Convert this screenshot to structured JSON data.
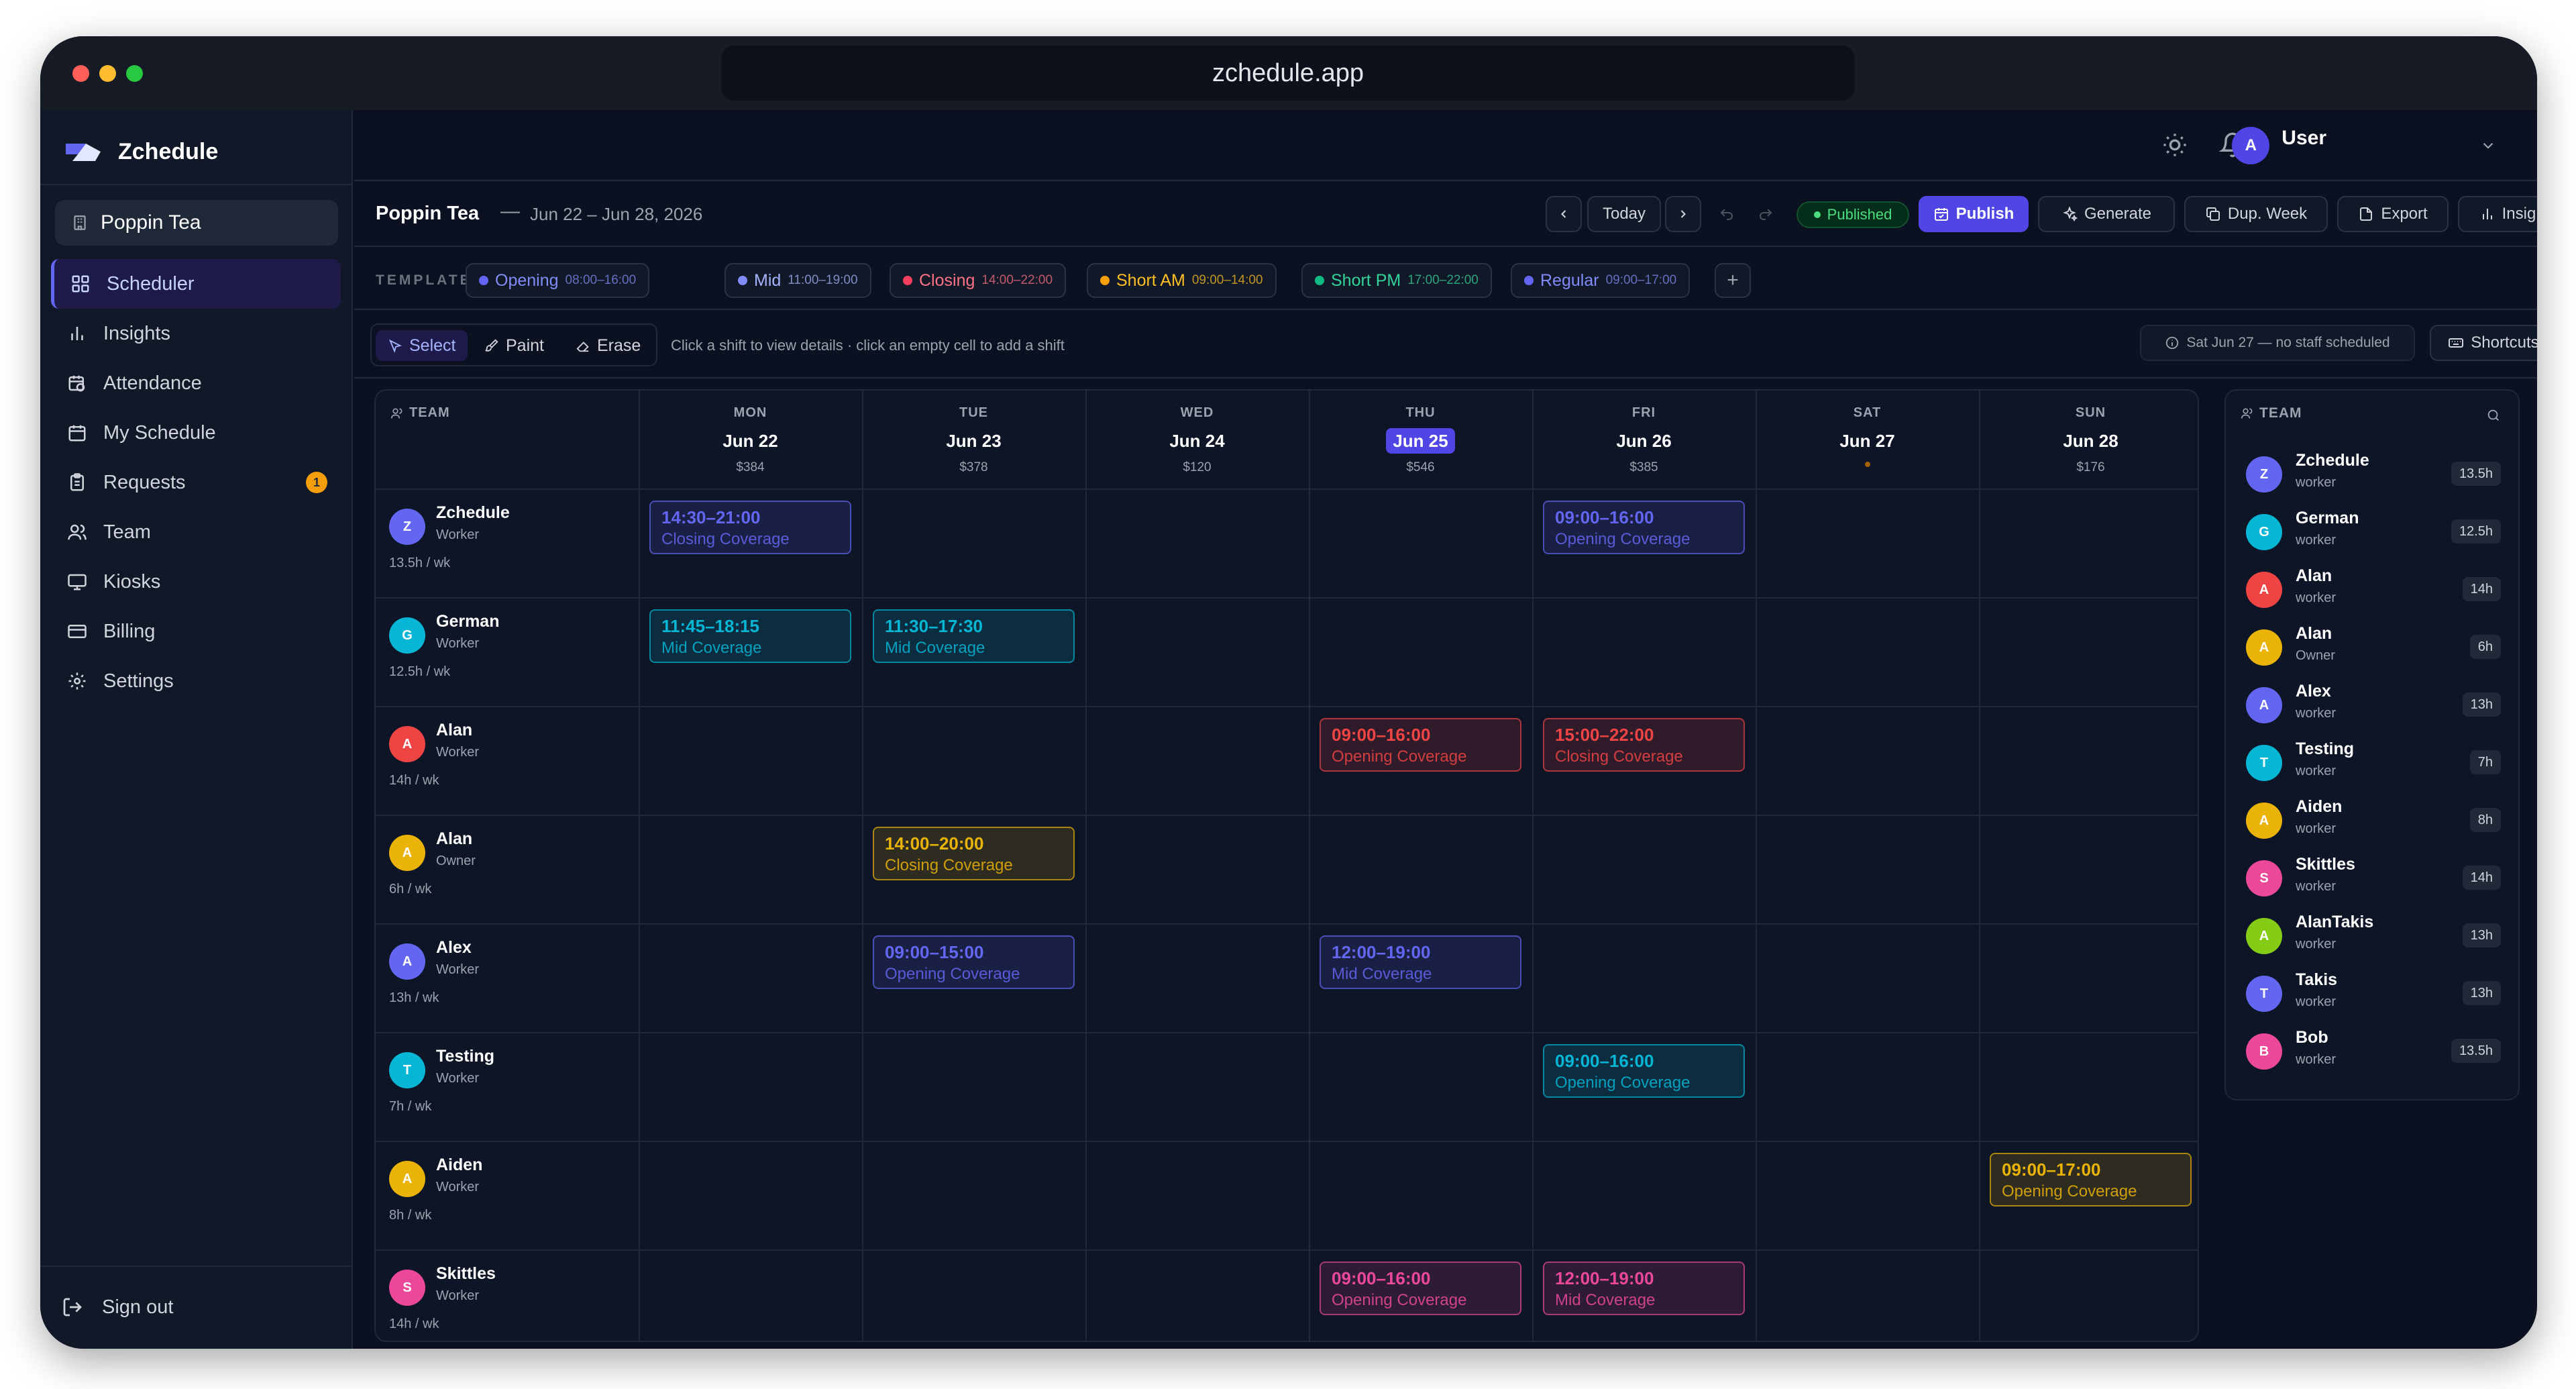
{
  "browser": {
    "url": "zchedule.app"
  },
  "app": {
    "name": "Zchedule",
    "org": "Poppin Tea"
  },
  "sidebar": {
    "items": [
      {
        "label": "Scheduler",
        "icon": "grid-icon",
        "active": true
      },
      {
        "label": "Insights",
        "icon": "bar-chart-icon"
      },
      {
        "label": "Attendance",
        "icon": "calendar-clock-icon"
      },
      {
        "label": "My Schedule",
        "icon": "calendar-icon"
      },
      {
        "label": "Requests",
        "icon": "clipboard-icon",
        "badge": "1"
      },
      {
        "label": "Team",
        "icon": "users-icon"
      },
      {
        "label": "Kiosks",
        "icon": "monitor-icon"
      },
      {
        "label": "Billing",
        "icon": "credit-card-icon"
      },
      {
        "label": "Settings",
        "icon": "gear-icon"
      }
    ],
    "signout": "Sign out"
  },
  "topbar": {
    "user_initial": "A",
    "user_name": "User"
  },
  "header": {
    "title": "Poppin Tea",
    "separator": "—",
    "range": "Jun 22 – Jun 28, 2026",
    "today": "Today",
    "status": "Published",
    "publish": "Publish",
    "generate": "Generate",
    "dup_week": "Dup. Week",
    "export": "Export",
    "insights": "Insights"
  },
  "templates": {
    "label": "TEMPLATES",
    "items": [
      {
        "name": "Opening",
        "time": "08:00–16:00",
        "color": "#6366f1"
      },
      {
        "name": "Mid",
        "time": "11:00–19:00",
        "color": "#818cf8"
      },
      {
        "name": "Closing",
        "time": "14:00–22:00",
        "color": "#f43f5e"
      },
      {
        "name": "Short AM",
        "time": "09:00–14:00",
        "color": "#f59e0b"
      },
      {
        "name": "Short PM",
        "time": "17:00–22:00",
        "color": "#10b981"
      },
      {
        "name": "Regular",
        "time": "09:00–17:00",
        "color": "#6366f1"
      }
    ],
    "add": "+"
  },
  "toolbar": {
    "select": "Select",
    "paint": "Paint",
    "erase": "Erase",
    "hint": "Click a shift to view details · click an empty cell to add a shift",
    "notice": "Sat Jun 27 — no staff scheduled",
    "shortcuts": "Shortcuts"
  },
  "grid": {
    "team_label": "TEAM",
    "days": [
      {
        "name": "MON",
        "date": "Jun 22",
        "cost": "$384"
      },
      {
        "name": "TUE",
        "date": "Jun 23",
        "cost": "$378"
      },
      {
        "name": "WED",
        "date": "Jun 24",
        "cost": "$120"
      },
      {
        "name": "THU",
        "date": "Jun 25",
        "cost": "$546",
        "today": true
      },
      {
        "name": "FRI",
        "date": "Jun 26",
        "cost": "$385"
      },
      {
        "name": "SAT",
        "date": "Jun 27",
        "cost": ""
      },
      {
        "name": "SUN",
        "date": "Jun 28",
        "cost": "$176"
      }
    ],
    "rows": [
      {
        "initial": "Z",
        "name": "Zchedule",
        "role": "Worker",
        "hours": "13.5h / wk",
        "color": "#6366f1",
        "shifts": [
          {
            "day": 0,
            "time": "14:30–21:00",
            "label": "Closing Coverage",
            "color": "#6366f1"
          },
          {
            "day": 4,
            "time": "09:00–16:00",
            "label": "Opening Coverage",
            "color": "#6366f1"
          }
        ]
      },
      {
        "initial": "G",
        "name": "German",
        "role": "Worker",
        "hours": "12.5h / wk",
        "color": "#06b6d4",
        "shifts": [
          {
            "day": 0,
            "time": "11:45–18:15",
            "label": "Mid Coverage",
            "color": "#06b6d4"
          },
          {
            "day": 1,
            "time": "11:30–17:30",
            "label": "Mid Coverage",
            "color": "#06b6d4"
          }
        ]
      },
      {
        "initial": "A",
        "name": "Alan",
        "role": "Worker",
        "hours": "14h / wk",
        "color": "#ef4444",
        "shifts": [
          {
            "day": 3,
            "time": "09:00–16:00",
            "label": "Opening Coverage",
            "color": "#ef4444"
          },
          {
            "day": 4,
            "time": "15:00–22:00",
            "label": "Closing Coverage",
            "color": "#ef4444"
          }
        ]
      },
      {
        "initial": "A",
        "name": "Alan",
        "role": "Owner",
        "hours": "6h / wk",
        "color": "#eab308",
        "shifts": [
          {
            "day": 1,
            "time": "14:00–20:00",
            "label": "Closing Coverage",
            "color": "#eab308"
          }
        ]
      },
      {
        "initial": "A",
        "name": "Alex",
        "role": "Worker",
        "hours": "13h / wk",
        "color": "#6366f1",
        "shifts": [
          {
            "day": 1,
            "time": "09:00–15:00",
            "label": "Opening Coverage",
            "color": "#6366f1"
          },
          {
            "day": 3,
            "time": "12:00–19:00",
            "label": "Mid Coverage",
            "color": "#6366f1"
          }
        ]
      },
      {
        "initial": "T",
        "name": "Testing",
        "role": "Worker",
        "hours": "7h / wk",
        "color": "#06b6d4",
        "shifts": [
          {
            "day": 4,
            "time": "09:00–16:00",
            "label": "Opening Coverage",
            "color": "#06b6d4"
          }
        ]
      },
      {
        "initial": "A",
        "name": "Aiden",
        "role": "Worker",
        "hours": "8h / wk",
        "color": "#eab308",
        "shifts": [
          {
            "day": 6,
            "time": "09:00–17:00",
            "label": "Opening Coverage",
            "color": "#eab308"
          }
        ]
      },
      {
        "initial": "S",
        "name": "Skittles",
        "role": "Worker",
        "hours": "14h / wk",
        "color": "#ec4899",
        "shifts": [
          {
            "day": 3,
            "time": "09:00–16:00",
            "label": "Opening Coverage",
            "color": "#ec4899"
          },
          {
            "day": 4,
            "time": "12:00–19:00",
            "label": "Mid Coverage",
            "color": "#ec4899"
          }
        ]
      }
    ]
  },
  "team_panel": {
    "title": "TEAM",
    "members": [
      {
        "initial": "Z",
        "name": "Zchedule",
        "role": "worker",
        "hours": "13.5h",
        "color": "#6366f1"
      },
      {
        "initial": "G",
        "name": "German",
        "role": "worker",
        "hours": "12.5h",
        "color": "#06b6d4"
      },
      {
        "initial": "A",
        "name": "Alan",
        "role": "worker",
        "hours": "14h",
        "color": "#ef4444"
      },
      {
        "initial": "A",
        "name": "Alan",
        "role": "Owner",
        "hours": "6h",
        "color": "#eab308"
      },
      {
        "initial": "A",
        "name": "Alex",
        "role": "worker",
        "hours": "13h",
        "color": "#6366f1"
      },
      {
        "initial": "T",
        "name": "Testing",
        "role": "worker",
        "hours": "7h",
        "color": "#06b6d4"
      },
      {
        "initial": "A",
        "name": "Aiden",
        "role": "worker",
        "hours": "8h",
        "color": "#eab308"
      },
      {
        "initial": "S",
        "name": "Skittles",
        "role": "worker",
        "hours": "14h",
        "color": "#ec4899"
      },
      {
        "initial": "A",
        "name": "AlanTakis",
        "role": "worker",
        "hours": "13h",
        "color": "#84cc16"
      },
      {
        "initial": "T",
        "name": "Takis",
        "role": "worker",
        "hours": "13h",
        "color": "#6366f1"
      },
      {
        "initial": "B",
        "name": "Bob",
        "role": "worker",
        "hours": "13.5h",
        "color": "#ec4899"
      }
    ]
  }
}
